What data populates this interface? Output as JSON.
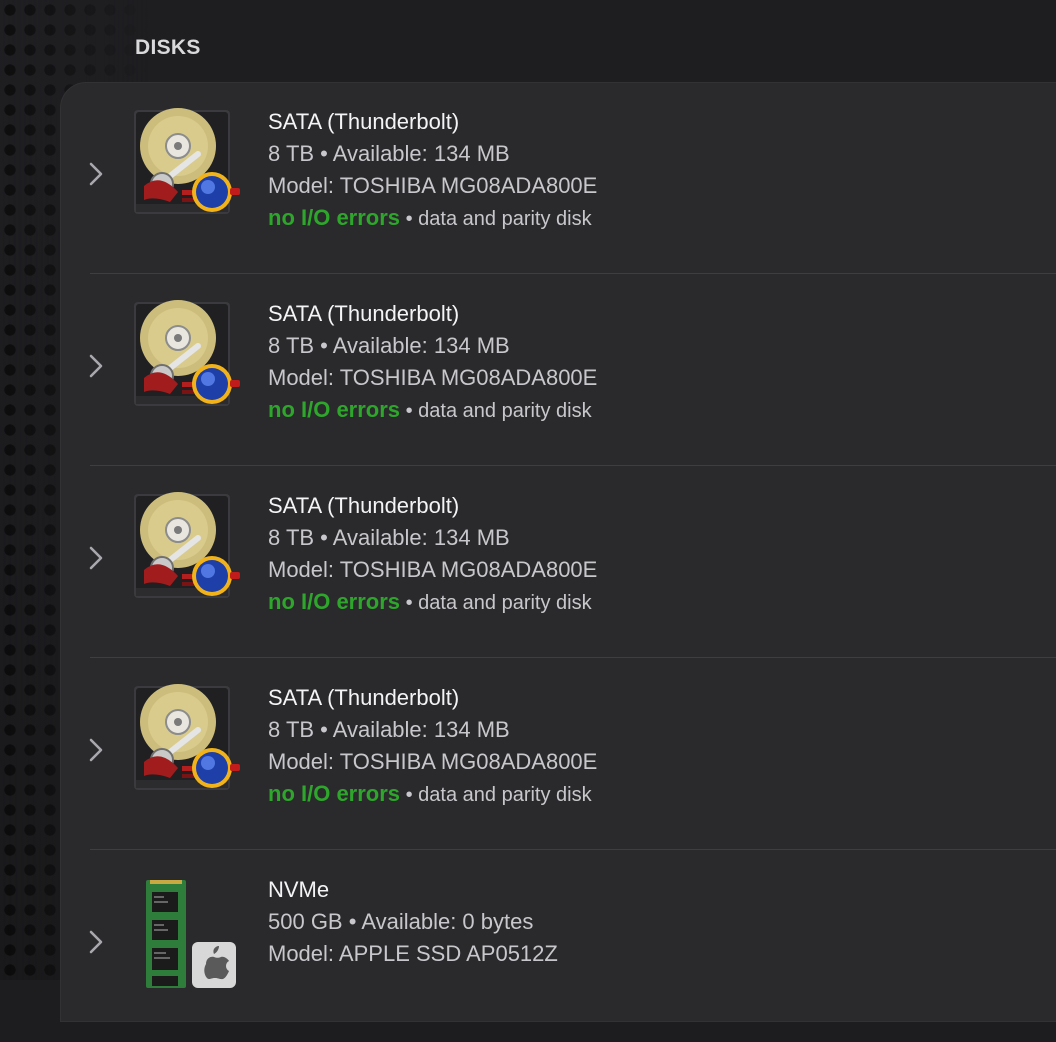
{
  "section": {
    "title": "DISKS"
  },
  "disks": [
    {
      "kind": "hdd",
      "title": "SATA  (Thunderbolt)",
      "capacity": "8 TB • Available: 134 MB",
      "model": "Model: TOSHIBA MG08ADA800E",
      "status": "no I/O errors",
      "separator": " • ",
      "role": "data and parity disk"
    },
    {
      "kind": "hdd",
      "title": "SATA  (Thunderbolt)",
      "capacity": "8 TB • Available: 134 MB",
      "model": "Model: TOSHIBA MG08ADA800E",
      "status": "no I/O errors",
      "separator": " • ",
      "role": "data and parity disk"
    },
    {
      "kind": "hdd",
      "title": "SATA  (Thunderbolt)",
      "capacity": "8 TB • Available: 134 MB",
      "model": "Model: TOSHIBA MG08ADA800E",
      "status": "no I/O errors",
      "separator": " • ",
      "role": "data and parity disk"
    },
    {
      "kind": "hdd",
      "title": "SATA  (Thunderbolt)",
      "capacity": "8 TB • Available: 134 MB",
      "model": "Model: TOSHIBA MG08ADA800E",
      "status": "no I/O errors",
      "separator": " • ",
      "role": "data and parity disk"
    },
    {
      "kind": "nvme",
      "title": "NVMe",
      "capacity": "500 GB • Available: 0 bytes",
      "model": "Model: APPLE SSD AP0512Z"
    }
  ],
  "icons": {
    "chevron": "chevron-right-icon",
    "hdd": "hard-drive-icon",
    "nvme": "nvme-ssd-icon"
  },
  "colors": {
    "status_good": "#2ea52b",
    "panel": "#2a2a2d",
    "background": "#1d1d20"
  }
}
